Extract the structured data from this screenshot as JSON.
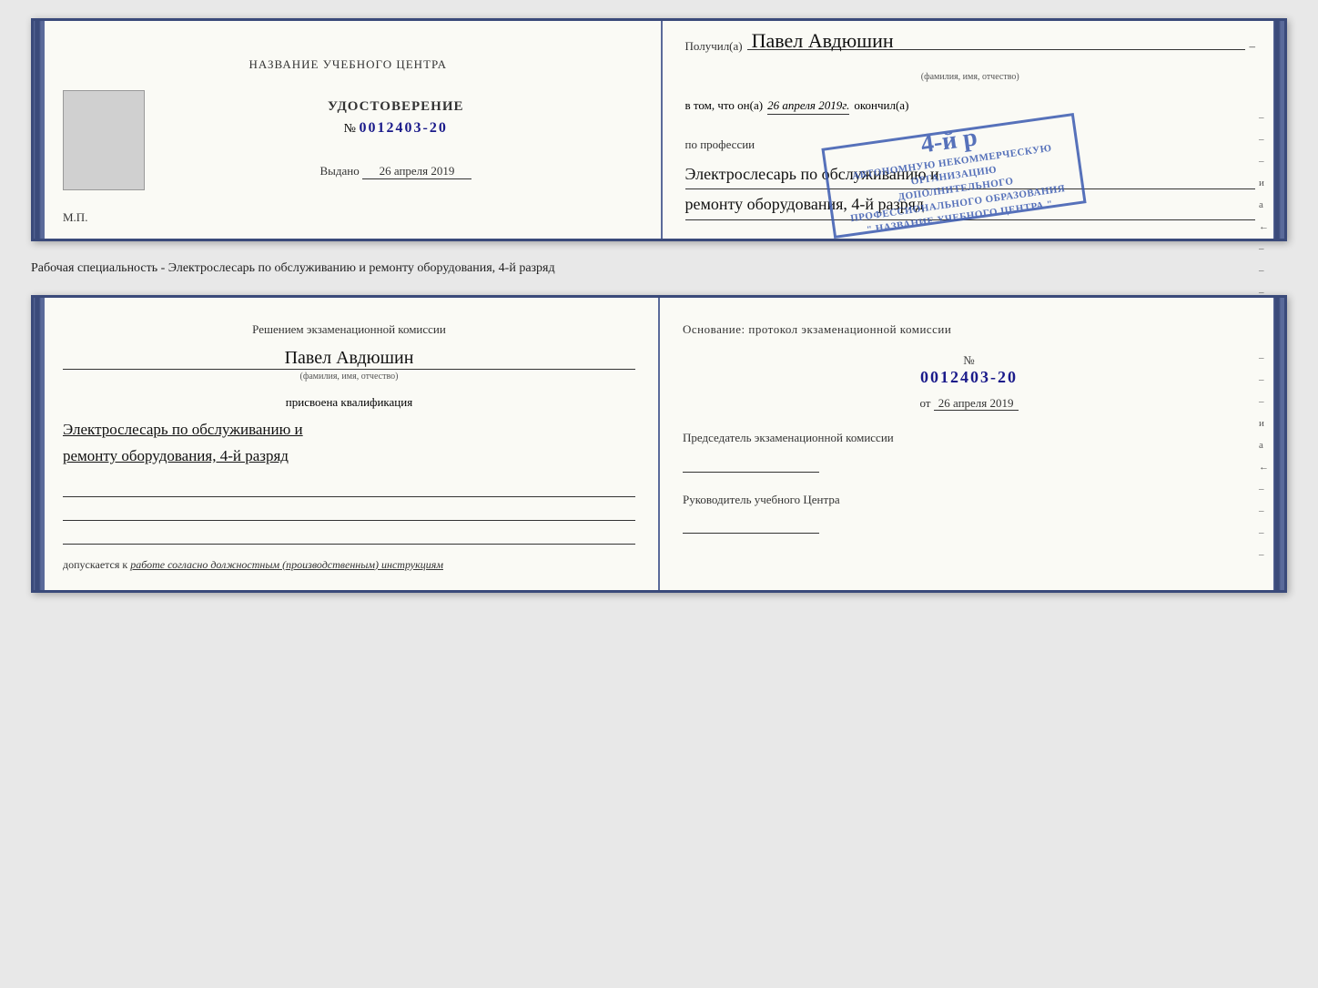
{
  "top_book": {
    "left": {
      "header": "НАЗВАНИЕ УЧЕБНОГО ЦЕНТРА",
      "cert_title": "УДОСТОВЕРЕНИЕ",
      "cert_number_label": "№",
      "cert_number": "0012403-20",
      "issued_label": "Выдано",
      "issued_date": "26 апреля 2019",
      "mp_label": "М.П."
    },
    "right": {
      "received_label": "Получил(а)",
      "name_handwritten": "Павел Авдюшин",
      "name_sublabel": "(фамилия, имя, отчество)",
      "vtom_label": "в том, что он(а)",
      "vtom_date_italic": "26 апреля 2019г.",
      "finished_label": "окончил(а)",
      "stamp_line1": "АВТОНОМНУЮ НЕКОММЕРЧЕСКУЮ ОРГАНИЗАЦИЮ",
      "stamp_line2": "ДОПОЛНИТЕЛЬНОГО ПРОФЕССИОНАЛЬНОГО ОБРАЗОВАНИЯ",
      "stamp_line3": "\" НАЗВАНИЕ УЧЕБНОГО ЦЕНТРА \"",
      "stamp_grade": "4-й р",
      "profession_label": "по профессии",
      "profession_line1": "Электрослесарь по обслуживанию и",
      "profession_line2": "ремонту оборудования, 4-й разряд",
      "side_marks": [
        "–",
        "–",
        "–",
        "и",
        "а",
        "←",
        "–",
        "–",
        "–"
      ]
    }
  },
  "separator": {
    "text": "Рабочая специальность - Электрослесарь по обслуживанию и ремонту оборудования, 4-й разряд"
  },
  "bottom_book": {
    "left": {
      "decision_text": "Решением экзаменационной комиссии",
      "name_handwritten": "Павел Авдюшин",
      "name_sublabel": "(фамилия, имя, отчество)",
      "assigned_label": "присвоена квалификация",
      "qual_line1": "Электрослесарь по обслуживанию и",
      "qual_line2": "ремонту оборудования, 4-й разряд",
      "допускается_label": "допускается к",
      "допускается_hand": "работе согласно должностным (производственным) инструкциям"
    },
    "right": {
      "osnov_label": "Основание: протокол экзаменационной комиссии",
      "number_label": "№",
      "number": "0012403-20",
      "from_label": "от",
      "from_date": "26 апреля 2019",
      "chairman_label": "Председатель экзаменационной комиссии",
      "director_label": "Руководитель учебного Центра",
      "side_marks": [
        "–",
        "–",
        "–",
        "и",
        "а",
        "←",
        "–",
        "–",
        "–",
        "–"
      ]
    }
  }
}
